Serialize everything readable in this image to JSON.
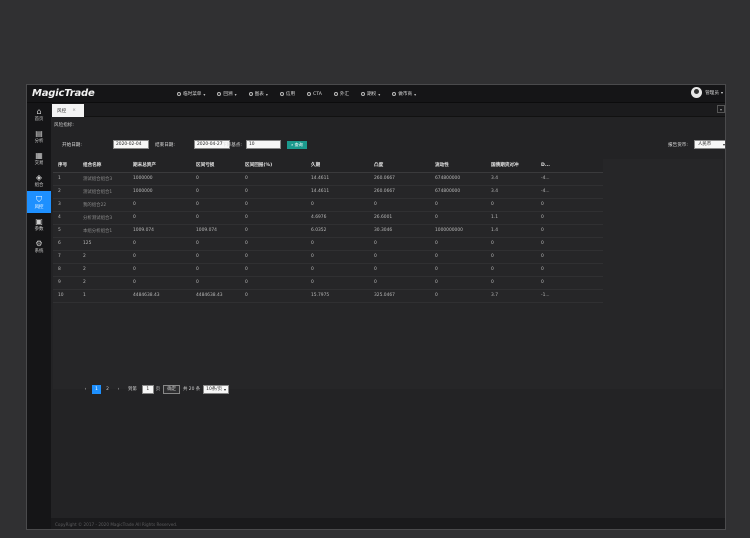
{
  "app": {
    "logo": "MagicTrade"
  },
  "topnav": [
    {
      "label": "临时菜单",
      "dropdown": true
    },
    {
      "label": "回溯",
      "dropdown": true
    },
    {
      "label": "图表",
      "dropdown": true
    },
    {
      "label": "信用",
      "dropdown": false
    },
    {
      "label": "CTA",
      "dropdown": false
    },
    {
      "label": "外汇",
      "dropdown": false
    },
    {
      "label": "期权",
      "dropdown": true
    },
    {
      "label": "做市商",
      "dropdown": true
    }
  ],
  "user": {
    "name": "管理员"
  },
  "sidebar": [
    {
      "label": "首页",
      "icon": "home-icon",
      "glyph": "⌂",
      "active": false
    },
    {
      "label": "分析",
      "icon": "book-icon",
      "glyph": "▤",
      "active": false
    },
    {
      "label": "交易",
      "icon": "calendar-icon",
      "glyph": "▦",
      "active": false
    },
    {
      "label": "组合",
      "icon": "cube-icon",
      "glyph": "◈",
      "active": false
    },
    {
      "label": "风控",
      "icon": "shield-icon",
      "glyph": "⛉",
      "active": true
    },
    {
      "label": "参数",
      "icon": "layers-icon",
      "glyph": "▣",
      "active": false
    },
    {
      "label": "系统",
      "icon": "gear-icon",
      "glyph": "⚙",
      "active": false
    }
  ],
  "tab": {
    "label": "风控",
    "close": "×"
  },
  "breadcrumb": "风险指标:",
  "filters": {
    "start_label": "开始日期:",
    "start_value": "2020-02-04",
    "end_label": "结束日期:",
    "end_value": "2020-04-27",
    "bp_label": "下降基点:",
    "bp_value": "10",
    "query_label": "查询",
    "currency_label": "报告货币:",
    "currency_value": "人民币"
  },
  "table": {
    "columns": [
      "序号",
      "组合名称",
      "期末总资产",
      "区间亏损",
      "区间回报(%)",
      "久期",
      "凸度",
      "流动性",
      "国债期货对冲",
      "D..."
    ],
    "rows": [
      [
        "1",
        "测试组合组合3",
        "1000000",
        "0",
        "0",
        "14.4611",
        "260.0667",
        "674800000",
        "3.4",
        "-4..."
      ],
      [
        "2",
        "测试组合组合1",
        "1000000",
        "0",
        "0",
        "14.4611",
        "260.0667",
        "674800000",
        "3.4",
        "-4..."
      ],
      [
        "3",
        "我的组合22",
        "0",
        "0",
        "0",
        "0",
        "0",
        "0",
        "0",
        "0"
      ],
      [
        "4",
        "分析测试组合3",
        "0",
        "0",
        "0",
        "4.6976",
        "26.6001",
        "0",
        "1.1",
        "0"
      ],
      [
        "5",
        "本组分析组合1",
        "1009.074",
        "1009.074",
        "0",
        "6.0352",
        "30.3046",
        "1000000000",
        "1.4",
        "0"
      ],
      [
        "6",
        "125",
        "0",
        "0",
        "0",
        "0",
        "0",
        "0",
        "0",
        "0"
      ],
      [
        "7",
        "2",
        "0",
        "0",
        "0",
        "0",
        "0",
        "0",
        "0",
        "0"
      ],
      [
        "8",
        "2",
        "0",
        "0",
        "0",
        "0",
        "0",
        "0",
        "0",
        "0"
      ],
      [
        "9",
        "2",
        "0",
        "0",
        "0",
        "0",
        "0",
        "0",
        "0",
        "0"
      ],
      [
        "10",
        "1",
        "4484638.43",
        "4484638.43",
        "0",
        "15.7975",
        "325.0467",
        "0",
        "3.7",
        "-1..."
      ]
    ]
  },
  "pager": {
    "prev": "‹",
    "pages": [
      "1",
      "2"
    ],
    "current": "1",
    "next": "›",
    "goto_label": "到第",
    "goto_value": "1",
    "page_unit": "页",
    "confirm": "确定",
    "total": "共 20 条",
    "per_page": "10条/页"
  },
  "footer": "CopyRight © 2017 - 2020 MagicTrade All Rights Reserved."
}
